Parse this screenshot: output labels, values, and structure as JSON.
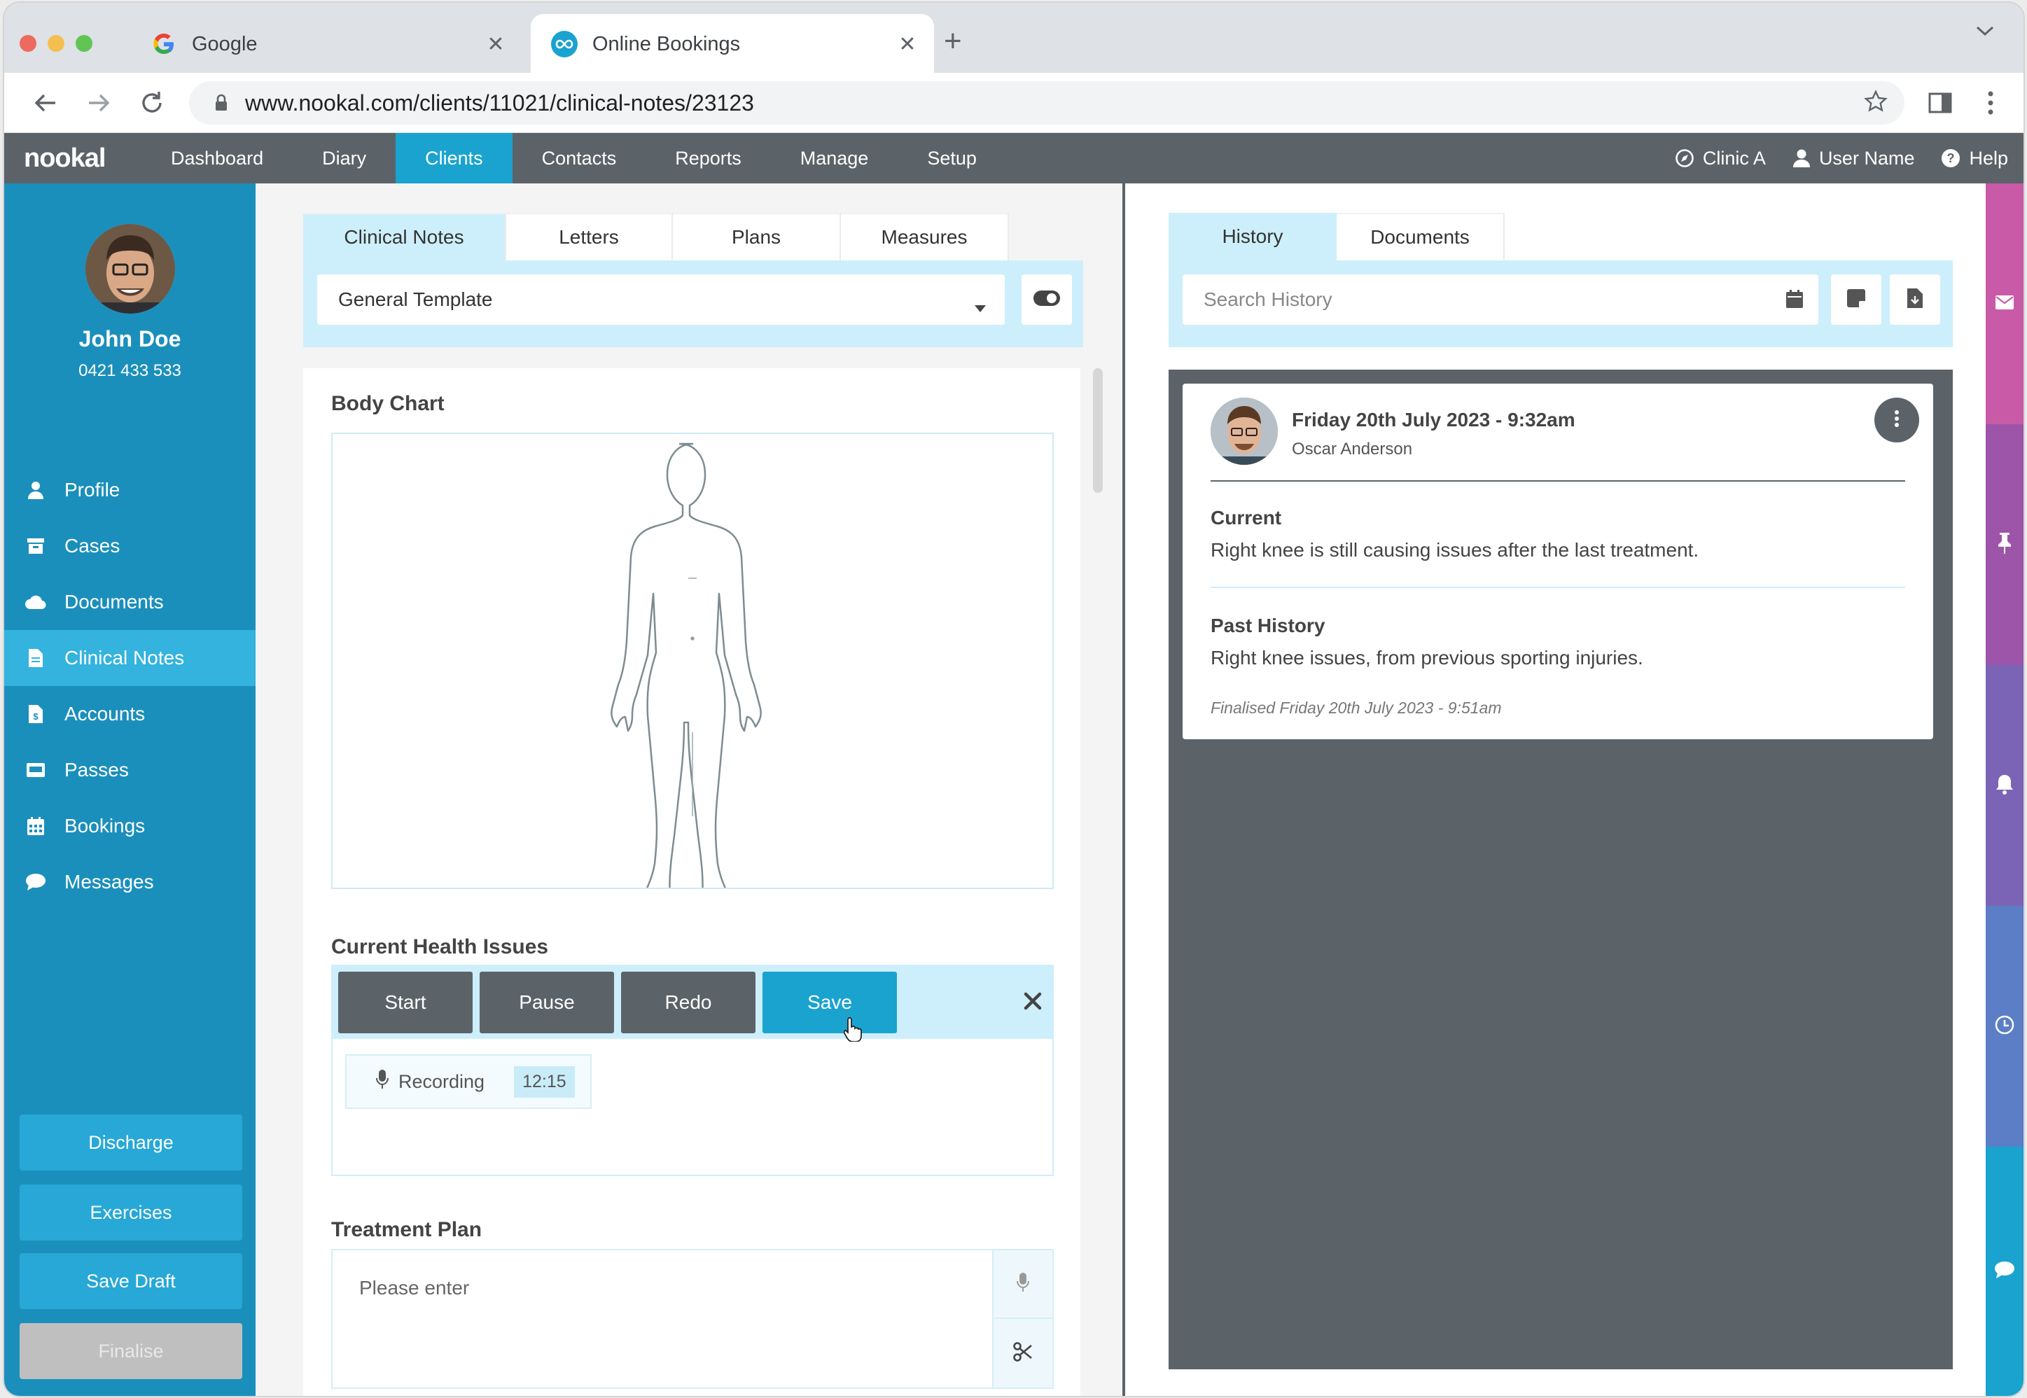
{
  "browser": {
    "tabs": [
      {
        "title": "Google"
      },
      {
        "title": "Online Bookings"
      }
    ],
    "url": "www.nookal.com/clients/11021/clinical-notes/23123"
  },
  "app": {
    "logo": "nookal",
    "nav": [
      "Dashboard",
      "Diary",
      "Clients",
      "Contacts",
      "Reports",
      "Manage",
      "Setup"
    ],
    "active_nav": "Clients",
    "clinic": "Clinic A",
    "user": "User Name",
    "help": "Help",
    "accent_color": "#1aa3cf",
    "nav_color": "#5b6369"
  },
  "client": {
    "name": "John Doe",
    "phone": "0421 433 533"
  },
  "sidebar": {
    "items": [
      {
        "label": "Profile",
        "icon": "user-icon"
      },
      {
        "label": "Cases",
        "icon": "archive-icon"
      },
      {
        "label": "Documents",
        "icon": "cloud-icon"
      },
      {
        "label": "Clinical Notes",
        "icon": "file-icon"
      },
      {
        "label": "Accounts",
        "icon": "invoice-icon"
      },
      {
        "label": "Passes",
        "icon": "pass-icon"
      },
      {
        "label": "Bookings",
        "icon": "calendar-icon"
      },
      {
        "label": "Messages",
        "icon": "chat-icon"
      }
    ],
    "active": "Clinical Notes",
    "buttons": {
      "discharge": "Discharge",
      "exercises": "Exercises",
      "save_draft": "Save Draft",
      "finalise": "Finalise"
    }
  },
  "notes": {
    "tabs": [
      "Clinical Notes",
      "Letters",
      "Plans",
      "Measures"
    ],
    "active_tab": "Clinical Notes",
    "template": "General Template",
    "body_chart_title": "Body Chart",
    "health_issues_title": "Current Health Issues",
    "recorder": {
      "start": "Start",
      "pause": "Pause",
      "redo": "Redo",
      "save": "Save",
      "status": "Recording",
      "time": "12:15"
    },
    "treatment_plan_title": "Treatment Plan",
    "treatment_placeholder": "Please enter"
  },
  "history": {
    "tabs": [
      "History",
      "Documents"
    ],
    "active_tab": "History",
    "search_placeholder": "Search History",
    "entry": {
      "date": "Friday 20th July 2023 - 9:32am",
      "author": "Oscar Anderson",
      "current_label": "Current",
      "current_text": "Right knee is still causing issues after the last treatment.",
      "past_label": "Past History",
      "past_text": "Right knee issues, from previous sporting injuries.",
      "finalised": "Finalised Friday 20th July 2023 - 9:51am"
    }
  },
  "right_strip": {
    "icons": [
      "envelope-icon",
      "pin-icon",
      "bell-icon",
      "clock-icon",
      "chat-icon"
    ],
    "colors": [
      "#c95aa7",
      "#9c55a8",
      "#7b64b6",
      "#5b7ec6",
      "#1aa3cf"
    ]
  }
}
